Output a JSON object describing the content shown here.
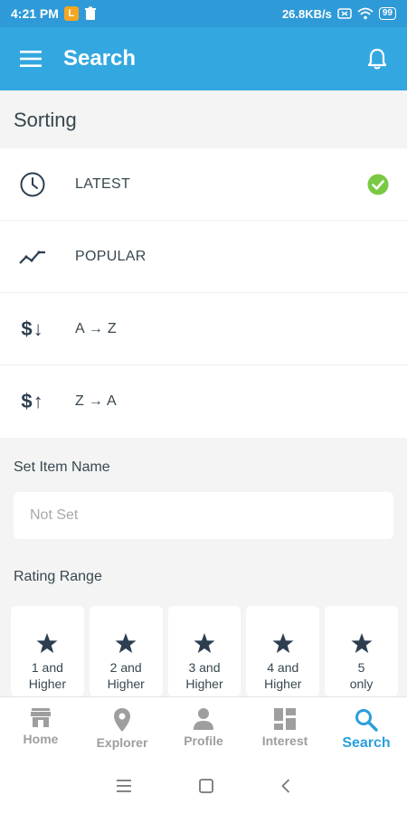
{
  "status_bar": {
    "time": "4:21 PM",
    "app_badge": "L",
    "network_speed": "26.8KB/s",
    "battery": "99"
  },
  "app_bar": {
    "title": "Search",
    "menu_icon": "hamburger-menu-icon",
    "notification_icon": "bell-icon"
  },
  "sorting": {
    "title": "Sorting",
    "options": [
      {
        "label": "LATEST",
        "icon": "clock-icon",
        "selected": true
      },
      {
        "label": "POPULAR",
        "icon": "trending-icon",
        "selected": false
      },
      {
        "label": "A → Z",
        "icon": "dollar-down-icon",
        "icon_text": "$↓",
        "selected": false
      },
      {
        "label": "Z → A",
        "icon": "dollar-up-icon",
        "icon_text": "$↑",
        "selected": false
      }
    ]
  },
  "item_name": {
    "label": "Set Item Name",
    "placeholder": "Not Set"
  },
  "rating_range": {
    "label": "Rating Range",
    "options": [
      {
        "line1": "1 and",
        "line2": "Higher"
      },
      {
        "line1": "2 and",
        "line2": "Higher"
      },
      {
        "line1": "3 and",
        "line2": "Higher"
      },
      {
        "line1": "4 and",
        "line2": "Higher"
      },
      {
        "line1": "5",
        "line2": "only"
      }
    ]
  },
  "bottom_nav": [
    {
      "label": "Home",
      "icon": "home-icon",
      "active": false
    },
    {
      "label": "Explorer",
      "icon": "location-pin-icon",
      "active": false
    },
    {
      "label": "Profile",
      "icon": "person-icon",
      "active": false
    },
    {
      "label": "Interest",
      "icon": "dashboard-icon",
      "active": false
    },
    {
      "label": "Search",
      "icon": "search-icon",
      "active": true
    }
  ],
  "colors": {
    "primary": "#33a8e0",
    "status_bar": "#2f9ad8",
    "active_nav": "#2b9fdc",
    "check": "#7ac943",
    "icon_dark": "#2d3e50"
  }
}
